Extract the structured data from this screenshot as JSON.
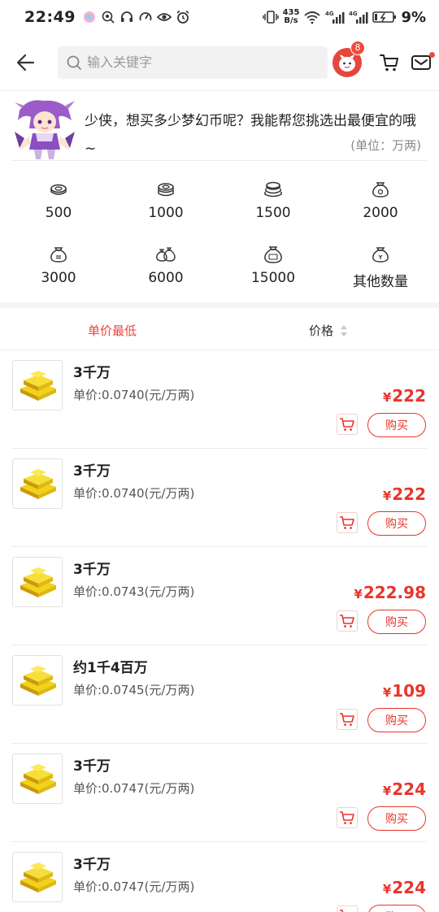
{
  "status_bar": {
    "time": "22:49",
    "net_speed_value": "435",
    "net_speed_unit": "B/s",
    "signal_1": "4G",
    "signal_2": "4G",
    "battery": "9%"
  },
  "header": {
    "search_placeholder": "输入关键字",
    "avatar_badge": "8"
  },
  "assistant": {
    "message": "少侠，想买多少梦幻币呢？我能帮您挑选出最便宜的哦~",
    "unit_note": "(单位：万两)"
  },
  "amounts": [
    {
      "label": "500",
      "icon": "coin-stack-small-icon"
    },
    {
      "label": "1000",
      "icon": "coin-stack-icon"
    },
    {
      "label": "1500",
      "icon": "coin-stack-large-icon"
    },
    {
      "label": "2000",
      "icon": "money-bag-icon"
    },
    {
      "label": "3000",
      "icon": "money-bag-icon"
    },
    {
      "label": "6000",
      "icon": "money-bags-icon"
    },
    {
      "label": "15000",
      "icon": "money-bag-large-icon"
    },
    {
      "label": "其他数量",
      "icon": "money-bag-icon"
    }
  ],
  "sort": {
    "lowest_label": "单价最低",
    "price_label": "价格"
  },
  "listings": [
    {
      "title": "3千万",
      "unit_price": "单价:0.0740(元/万两)",
      "currency": "¥",
      "price": "222",
      "buy_label": "购买"
    },
    {
      "title": "3千万",
      "unit_price": "单价:0.0740(元/万两)",
      "currency": "¥",
      "price": "222",
      "buy_label": "购买"
    },
    {
      "title": "3千万",
      "unit_price": "单价:0.0743(元/万两)",
      "currency": "¥",
      "price": "222.98",
      "buy_label": "购买"
    },
    {
      "title": "约1千4百万",
      "unit_price": "单价:0.0745(元/万两)",
      "currency": "¥",
      "price": "109",
      "buy_label": "购买"
    },
    {
      "title": "3千万",
      "unit_price": "单价:0.0747(元/万两)",
      "currency": "¥",
      "price": "224",
      "buy_label": "购买"
    },
    {
      "title": "3千万",
      "unit_price": "单价:0.0747(元/万两)",
      "currency": "¥",
      "price": "224",
      "buy_label": "购买"
    }
  ],
  "colors": {
    "accent": "#e8352b",
    "gold": "#f2d21a"
  }
}
